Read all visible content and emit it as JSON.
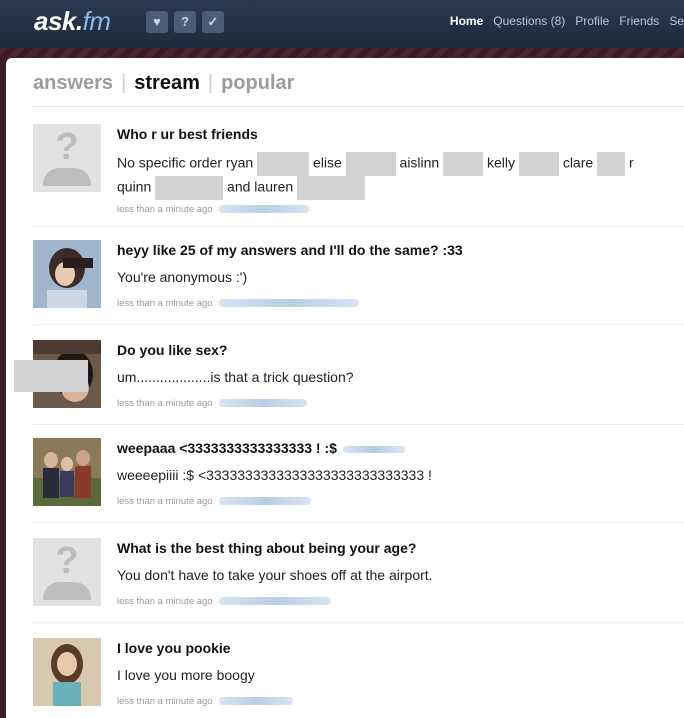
{
  "app": {
    "logo_main": "ask.",
    "logo_accent": "fm",
    "icons": [
      "heart-icon",
      "question-icon",
      "check-icon"
    ]
  },
  "topnav": {
    "items": [
      "Home",
      "Questions (8)",
      "Profile",
      "Friends",
      "Se"
    ]
  },
  "tabs": {
    "answers": "answers",
    "stream": "stream",
    "popular": "popular"
  },
  "feed": [
    {
      "question": "Who r ur best friends",
      "answer_parts": [
        "No specific order ryan",
        "elise",
        "aislinn",
        "kelly",
        "clare",
        "r",
        "quinn",
        "and lauren"
      ],
      "time": "less than a minute ago",
      "avatar": "generic"
    },
    {
      "question": "heyy like 25 of my answers and I'll do the same? :33",
      "answer": "You're anonymous :')",
      "time": "less than a minute ago",
      "avatar": "photo"
    },
    {
      "question": "Do you like sex?",
      "answer": "um...................is that a trick question?",
      "time": "less than a minute ago",
      "avatar": "photo"
    },
    {
      "question": "weepaaa <3333333333333333 ! :$",
      "answer": "weeeepiiii :$ <3333333333333333333333333333 !",
      "time": "less than a minute ago",
      "avatar": "photo"
    },
    {
      "question": "What is the best thing about being your age?",
      "answer": "You don't have to take your shoes off at the airport.",
      "time": "less than a minute ago",
      "avatar": "generic"
    },
    {
      "question": "I love you pookie",
      "answer": "I love you more boogy",
      "time": "less than a minute ago",
      "avatar": "photo"
    }
  ]
}
